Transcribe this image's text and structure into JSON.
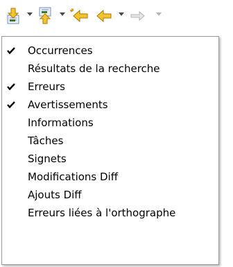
{
  "toolbar": {
    "buttons": [
      {
        "icon": "next-annotation-icon"
      },
      {
        "icon": "previous-annotation-icon"
      },
      {
        "icon": "last-edit-location-icon"
      },
      {
        "icon": "back-arrow-icon"
      },
      {
        "icon": "forward-arrow-icon",
        "disabled": true
      }
    ]
  },
  "menu": {
    "items": [
      {
        "label": "Occurrences",
        "checked": true
      },
      {
        "label": "Résultats de la recherche",
        "checked": false
      },
      {
        "label": "Erreurs",
        "checked": true
      },
      {
        "label": "Avertissements",
        "checked": true
      },
      {
        "label": "Informations",
        "checked": false
      },
      {
        "label": "Tâches",
        "checked": false
      },
      {
        "label": "Signets",
        "checked": false
      },
      {
        "label": "Modifications Diff",
        "checked": false
      },
      {
        "label": "Ajouts Diff",
        "checked": false
      },
      {
        "label": "Erreurs liées à l'orthographe",
        "checked": false
      }
    ]
  },
  "colors": {
    "menu_border": "#9a9a9a",
    "arrow_yellow": "#f4c430",
    "arrow_outline": "#b07800",
    "disabled": "#b5b5b5"
  }
}
